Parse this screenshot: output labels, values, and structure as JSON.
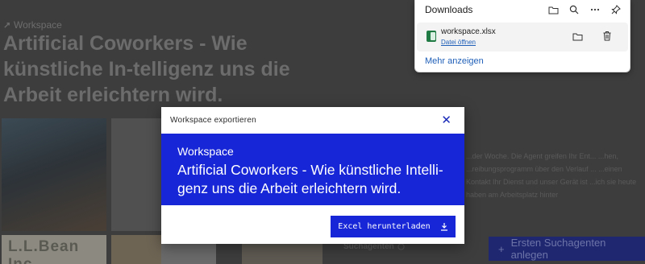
{
  "background_page": {
    "breadcrumb": "Workspace",
    "title": "Artificial Coworkers - Wie künstliche In-telligenz uns die Arbeit erleichtern wird.",
    "tile_text": "L.L.Bean Inc.",
    "side_text": "...der Woche. Die Agent greifen Ihr Ent... ...hen, ...reibungsprogramm über den Verlauf ... ...einen Kontakt Ihr Dienst und unser Gerät ist ...ich sie heute haben am Arbeitsplatz hinter",
    "side_label": "Suchagenten",
    "agent_button": "Ersten Suchagenten anlegen"
  },
  "downloads": {
    "title": "Downloads",
    "file_name": "workspace.xlsx",
    "open_link": "Datei öffnen",
    "more_link": "Mehr anzeigen",
    "accent": "#1f5fb8"
  },
  "modal": {
    "title": "Workspace exportieren",
    "banner_label": "Workspace",
    "banner_name": "Artificial Coworkers - Wie künstliche Intelli-genz uns die Arbeit erleichtern wird.",
    "download_button": "Excel herunterladen",
    "accent": "#1726d6"
  },
  "icons": {
    "folder": "folder-icon",
    "search": "search-icon",
    "more": "more-icon",
    "pin": "pin-icon",
    "trash": "trash-icon",
    "close": "close-icon",
    "download": "download-icon",
    "excel": "excel-file-icon"
  }
}
